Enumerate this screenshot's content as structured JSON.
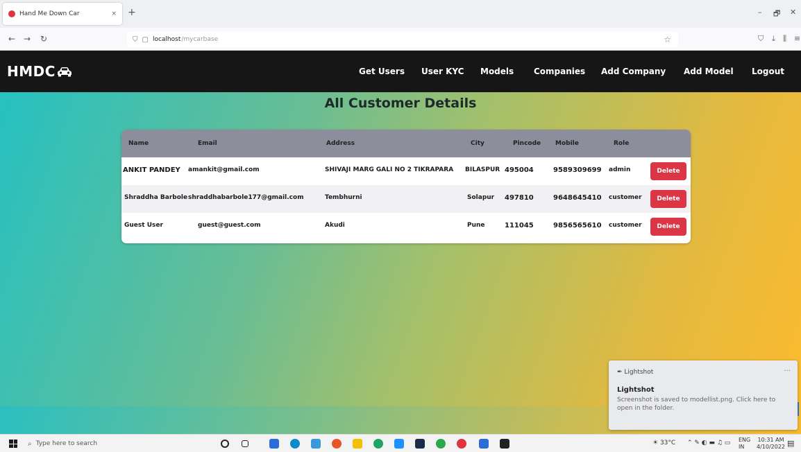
{
  "browser": {
    "tab_title": "Hand Me Down Car",
    "tab_close": "×",
    "new_tab": "+",
    "url_host": "localhost",
    "url_path": "/mycarbase",
    "win_min": "–",
    "win_max": "🗗",
    "win_close": "✕"
  },
  "nav": {
    "brand": "HMDC",
    "links": [
      "Get Users",
      "User KYC",
      "Models",
      "Companies",
      "Add Company",
      "Add Model",
      "Logout"
    ]
  },
  "page": {
    "title": "All Customer Details"
  },
  "table": {
    "headers": [
      "Name",
      "Email",
      "Address",
      "City",
      "Pincode",
      "Mobile",
      "Role"
    ],
    "rows": [
      {
        "name": "ANKIT PANDEY",
        "email": "amankit@gmail.com",
        "address": "SHIVAJI MARG GALI NO 2 TIKRAPARA",
        "city": "BILASPUR",
        "pincode": "495004",
        "mobile": "9589309699",
        "role": "admin",
        "action": "Delete"
      },
      {
        "name": "Shraddha Barbole",
        "email": "shraddhabarbole177@gmail.com",
        "address": "Tembhurni",
        "city": "Solapur",
        "pincode": "497810",
        "mobile": "9648645410",
        "role": "customer",
        "action": "Delete"
      },
      {
        "name": "Guest User",
        "email": "guest@guest.com",
        "address": "Akudi",
        "city": "Pune",
        "pincode": "111045",
        "mobile": "9856565610",
        "role": "customer",
        "action": "Delete"
      }
    ]
  },
  "toast": {
    "app": "Lightshot",
    "title": "Lightshot",
    "body": "Screenshot is saved to modellist.png. Click here to open in the folder.",
    "dots": "···"
  },
  "taskbar": {
    "search_placeholder": "Type here to search",
    "weather": "33°C",
    "lang": "ENG IN",
    "time": "10:31 AM",
    "date": "4/10/2022"
  },
  "colors": {
    "nav_bg": "#161616",
    "delete_btn": "#dc3545",
    "header_bg": "#8d8e9b"
  }
}
